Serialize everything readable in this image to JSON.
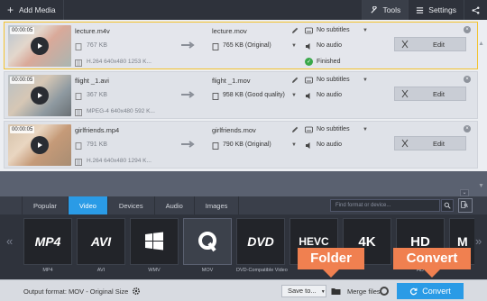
{
  "toolbar": {
    "add_media_label": "Add Media",
    "tools_label": "Tools",
    "settings_label": "Settings"
  },
  "files": [
    {
      "duration": "00:00:05",
      "source_name": "lecture.m4v",
      "source_size": "767 KB",
      "source_codec": "H.264 640x480 1253 K...",
      "output_name": "lecture.mov",
      "output_size": "765 KB (Original)",
      "subtitles": "No subtitles",
      "audio": "No audio",
      "status": "Finished",
      "edit_label": "Edit"
    },
    {
      "duration": "00:00:05",
      "source_name": "flight _1.avi",
      "source_size": "367 KB",
      "source_codec": "MPEG-4 640x480 592 K...",
      "output_name": "flight _1.mov",
      "output_size": "958 KB (Good quality)",
      "subtitles": "No subtitles",
      "audio": "No audio",
      "edit_label": "Edit"
    },
    {
      "duration": "00:00:05",
      "source_name": "girlfriends.mp4",
      "source_size": "791 KB",
      "source_codec": "H.264 640x480 1294 K...",
      "output_name": "girlfriends.mov",
      "output_size": "790 KB (Original)",
      "subtitles": "No subtitles",
      "audio": "No audio",
      "edit_label": "Edit"
    }
  ],
  "format_tabs": [
    "Popular",
    "Video",
    "Devices",
    "Audio",
    "Images"
  ],
  "active_tab": "Video",
  "search": {
    "placeholder": "Find format or device..."
  },
  "formats": [
    {
      "logo": "MP4",
      "caption": "MP4"
    },
    {
      "logo": "AVI",
      "caption": "AVI"
    },
    {
      "logo": "windows-logo",
      "caption": "WMV"
    },
    {
      "logo": "quicktime-logo",
      "caption": "MOV"
    },
    {
      "logo": "DVD",
      "caption": "DVD-Compatible Video"
    },
    {
      "logo": "HEVC",
      "caption": ""
    },
    {
      "logo": "4K",
      "caption": ""
    },
    {
      "logo": "HD",
      "caption": "HD"
    },
    {
      "logo": "M",
      "caption": ""
    }
  ],
  "active_format": "MOV",
  "bottom": {
    "output_format": "Output format: MOV - Original Size",
    "save_to_label": "Save to...",
    "merge_label": "Merge files",
    "convert_label": "Convert"
  },
  "callouts": {
    "folder": "Folder",
    "convert": "Convert"
  },
  "colors": {
    "accent": "#2a9be6",
    "callout": "#f08050",
    "selected_border": "#f3c32f",
    "finished": "#3aa84a"
  }
}
